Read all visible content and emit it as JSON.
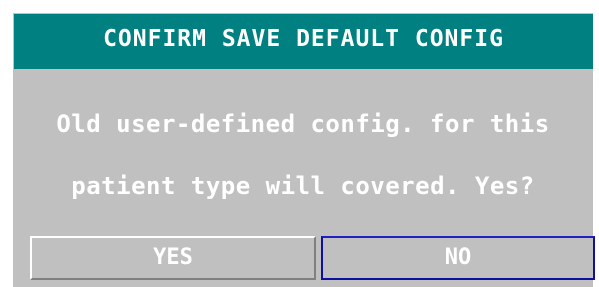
{
  "dialog": {
    "title": "CONFIRM SAVE DEFAULT CONFIG",
    "message_line1": "Old user-defined config. for this",
    "message_line2": "patient type will covered. Yes?",
    "yes_label": "YES",
    "no_label": "NO",
    "focused_button": "NO"
  },
  "colors": {
    "title_bar": "#008080",
    "dialog_background": "#c0c0c0",
    "text": "#ffffff",
    "focus_border": "#1010a0"
  }
}
